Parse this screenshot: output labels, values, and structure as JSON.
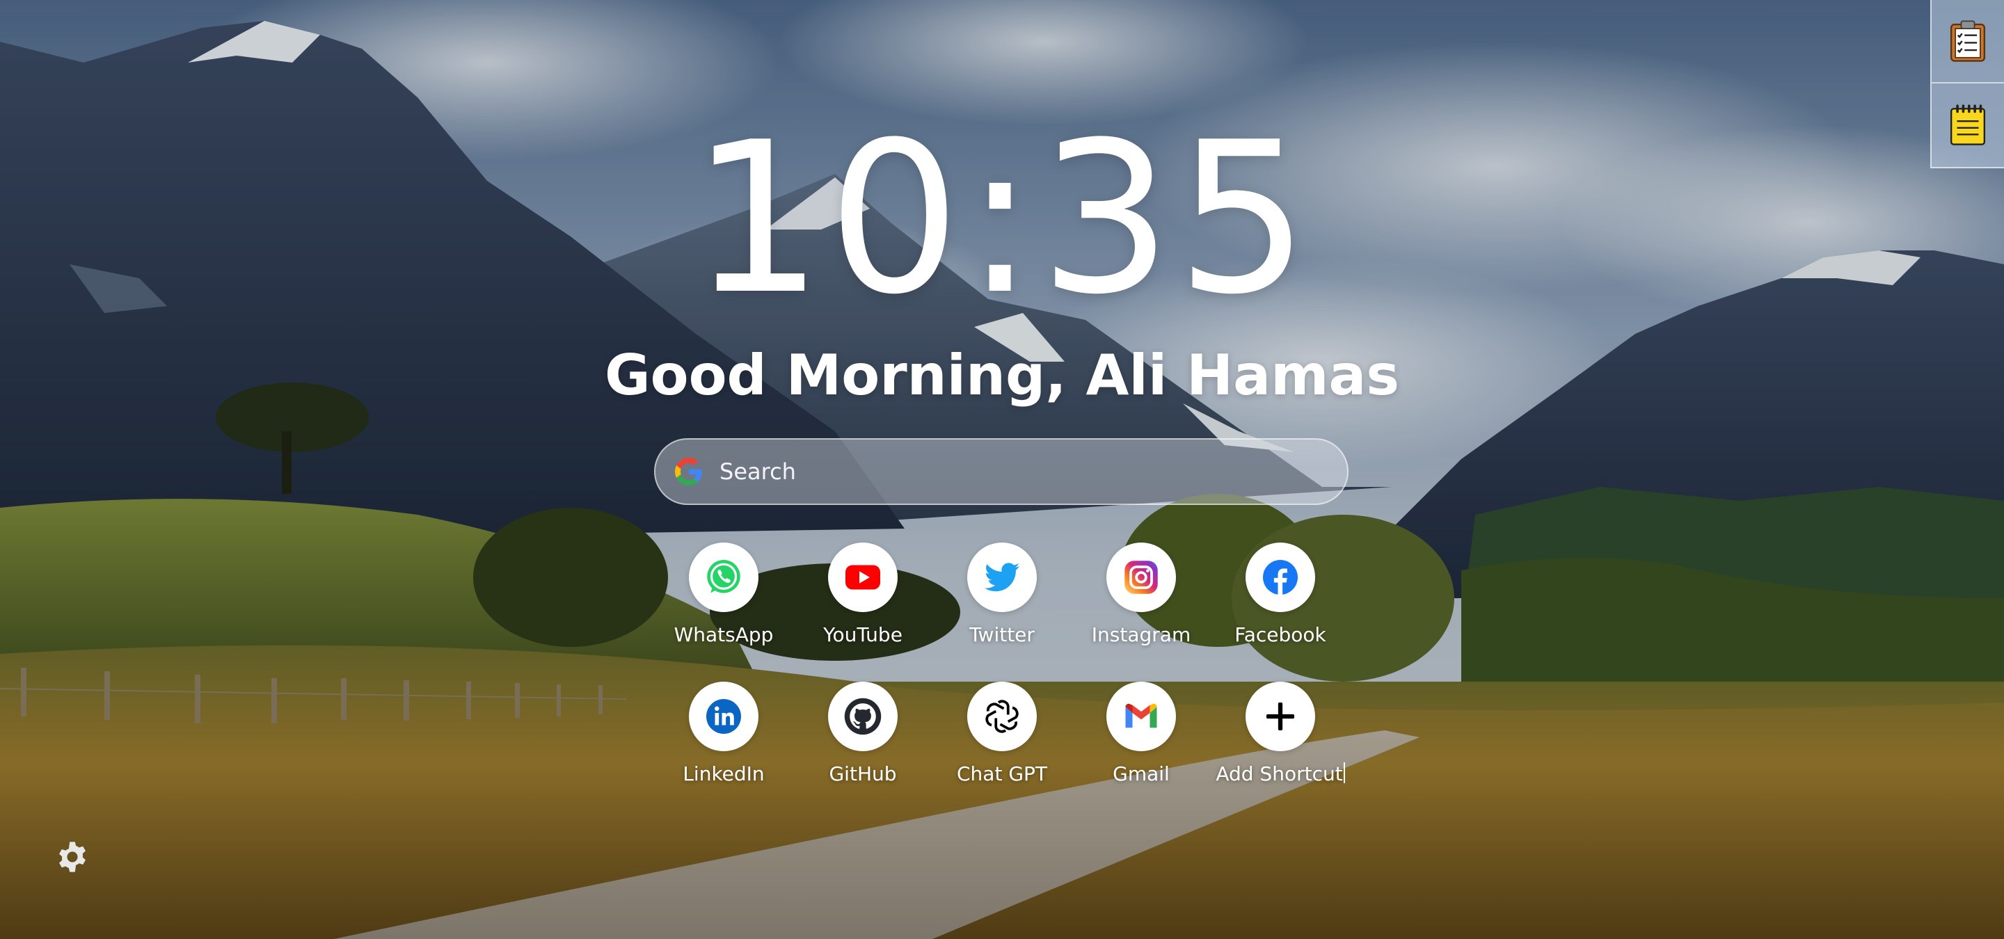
{
  "clock": {
    "time": "10:35"
  },
  "greeting": {
    "text": "Good Morning, Ali Hamas"
  },
  "search": {
    "placeholder": "Search",
    "value": "",
    "icon": "google-icon"
  },
  "shortcuts": {
    "row1": [
      {
        "label": "WhatsApp",
        "icon": "whatsapp-icon",
        "color": "#25D366"
      },
      {
        "label": "YouTube",
        "icon": "youtube-icon",
        "color": "#FF0000"
      },
      {
        "label": "Twitter",
        "icon": "twitter-icon",
        "color": "#1DA1F2"
      },
      {
        "label": "Instagram",
        "icon": "instagram-icon",
        "color": "#E1306C"
      },
      {
        "label": "Facebook",
        "icon": "facebook-icon",
        "color": "#1877F2"
      }
    ],
    "row2": [
      {
        "label": "LinkedIn",
        "icon": "linkedin-icon",
        "color": "#0A66C2"
      },
      {
        "label": "GitHub",
        "icon": "github-icon",
        "color": "#24292F"
      },
      {
        "label": "Chat GPT",
        "icon": "chatgpt-icon",
        "color": "#000000"
      },
      {
        "label": "Gmail",
        "icon": "gmail-icon",
        "color": "#EA4335"
      },
      {
        "label": "Add Shortcut",
        "icon": "plus-icon",
        "color": "#000000"
      }
    ]
  },
  "side_panel": {
    "buttons": [
      {
        "icon": "clipboard-checklist-icon"
      },
      {
        "icon": "notepad-icon"
      }
    ]
  },
  "settings": {
    "icon": "gear-icon"
  }
}
